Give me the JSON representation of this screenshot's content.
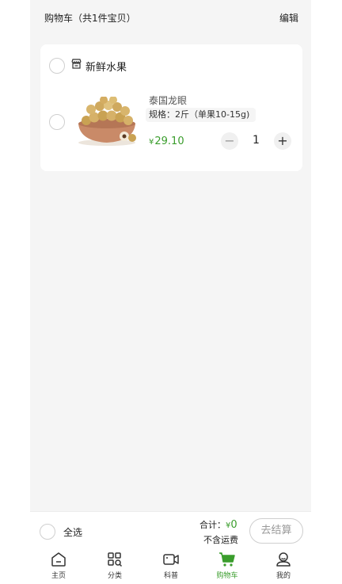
{
  "header": {
    "title": "购物车（共1件宝贝）",
    "edit_label": "编辑"
  },
  "store": {
    "name": "新鲜水果",
    "icon": "store-icon"
  },
  "item": {
    "name": "泰国龙眼",
    "spec": "规格：2斤（单果10-15g)",
    "currency": "¥",
    "price": "29.10",
    "quantity": "1",
    "minus": "−",
    "plus": "+"
  },
  "footer": {
    "select_all_label": "全选",
    "total_label": "合计：",
    "total_currency": "¥",
    "total_value": "0",
    "shipping_note": "不含运费",
    "checkout_label": "去结算"
  },
  "tabs": [
    {
      "label": "主页",
      "icon": "home-icon"
    },
    {
      "label": "分类",
      "icon": "category-icon"
    },
    {
      "label": "科普",
      "icon": "video-icon"
    },
    {
      "label": "购物车",
      "icon": "cart-icon",
      "active": true
    },
    {
      "label": "我的",
      "icon": "profile-icon"
    }
  ],
  "colors": {
    "accent": "#3a9d2c",
    "background": "#f5f5f5"
  }
}
